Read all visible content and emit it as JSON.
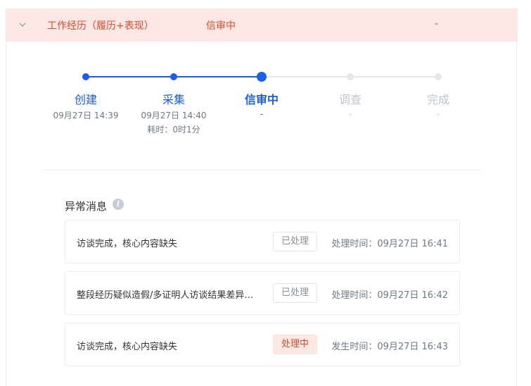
{
  "row": {
    "title": "工作经历（履历+表现）",
    "status": "信审中",
    "extra": "-"
  },
  "steps": [
    {
      "label": "创建",
      "time": "09月27日 14:39",
      "sub": "",
      "state": "done"
    },
    {
      "label": "采集",
      "time": "09月27日 14:40",
      "sub": "耗时：0时1分",
      "state": "done"
    },
    {
      "label": "信审中",
      "time": "-",
      "sub": "",
      "state": "current"
    },
    {
      "label": "调查",
      "time": "-",
      "sub": "",
      "state": "pending"
    },
    {
      "label": "完成",
      "time": "-",
      "sub": "",
      "state": "pending"
    }
  ],
  "colors": {
    "active": "#1a5ef0",
    "pending": "#e5e7ec",
    "pending_text": "#c0c4cc",
    "alert": "#e14b2b"
  },
  "anomaly": {
    "title": "异常消息",
    "info_icon": "info-icon",
    "messages": [
      {
        "text": "访谈完成，核心内容缺失",
        "badge": "已处理",
        "badge_type": "done",
        "time": "处理时间：09月27日 16:41"
      },
      {
        "text": "整段经历疑似造假/多证明人访谈结果差异较大",
        "badge": "已处理",
        "badge_type": "done",
        "time": "处理时间：09月27日 16:42"
      },
      {
        "text": "访谈完成，核心内容缺失",
        "badge": "处理中",
        "badge_type": "proc",
        "time": "发生时间：09月27日 16:43"
      }
    ]
  }
}
